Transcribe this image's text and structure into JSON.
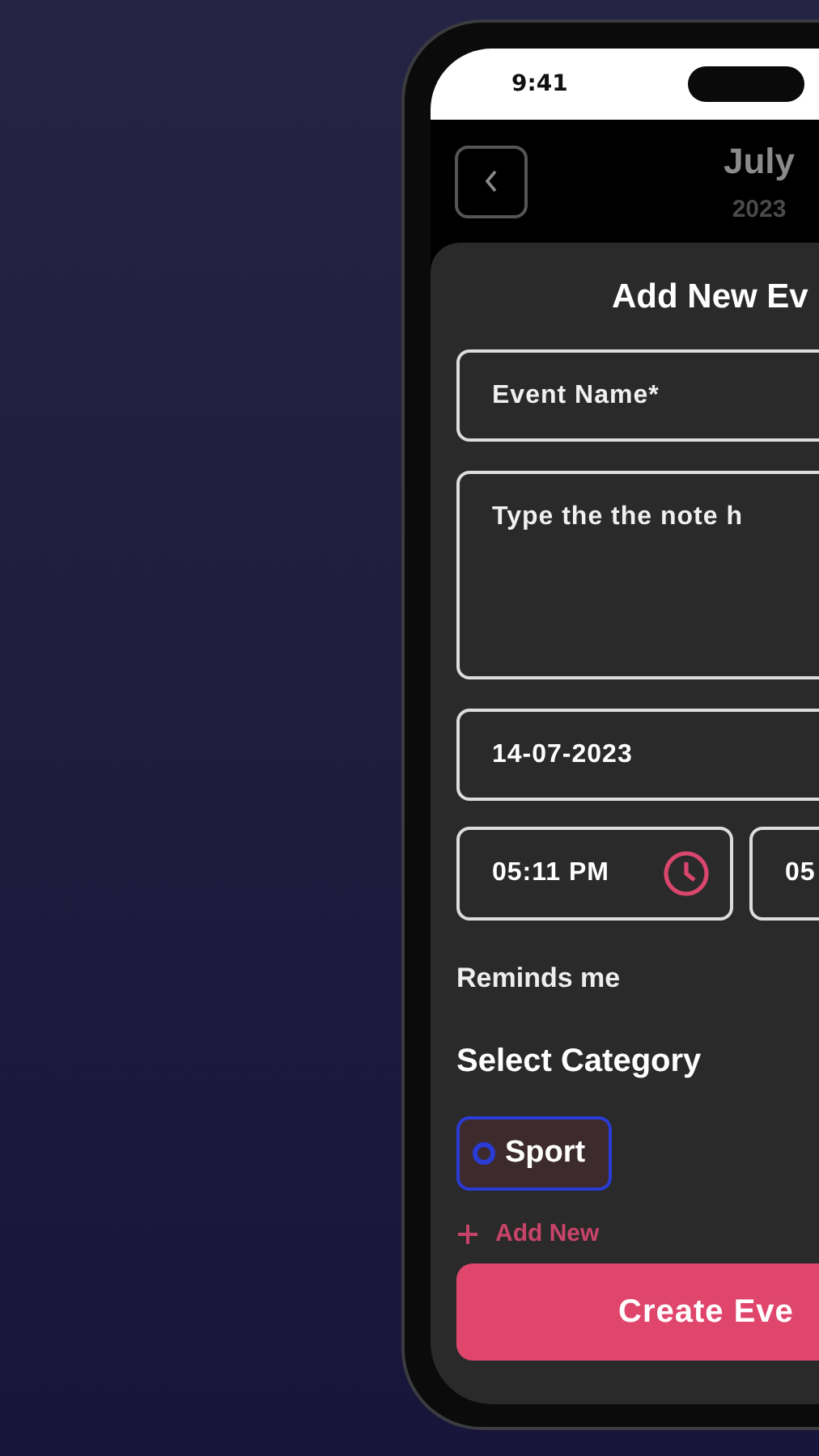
{
  "status_bar": {
    "time": "9:41"
  },
  "header": {
    "month": "July",
    "year": "2023"
  },
  "form": {
    "title": "Add New Ev",
    "fields": [
      {
        "kind": "text",
        "placeholder": "Event Name*"
      },
      {
        "kind": "textarea",
        "placeholder": "Type the the note h"
      },
      {
        "kind": "date",
        "value": "14-07-2023"
      }
    ],
    "times": [
      {
        "kind": "start",
        "value": "05:11 PM"
      },
      {
        "kind": "end",
        "value": "05"
      }
    ],
    "reminder_label": "Reminds me",
    "category_heading": "Select Category",
    "categories": [
      {
        "label": "Sport",
        "color": "#2a3bd6",
        "selected": true
      }
    ],
    "add_new": "Add New",
    "submit": "Create Eve"
  }
}
